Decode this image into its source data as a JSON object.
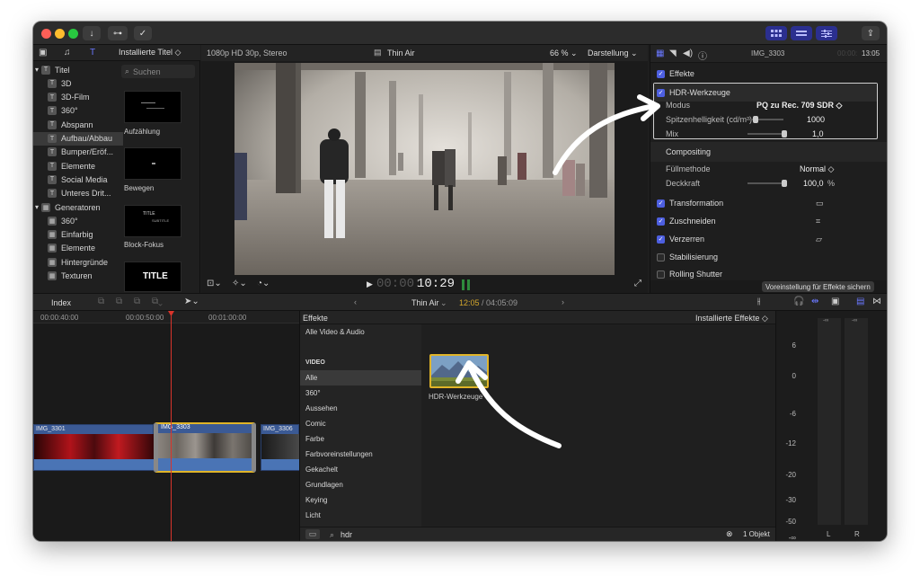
{
  "toolbar": {
    "download_icon": "↓",
    "key_icon": "⊶",
    "check_icon": "✓",
    "share_icon": "⇪"
  },
  "browser": {
    "header": "Installierte Titel ◇",
    "search_placeholder": "Suchen",
    "items": [
      {
        "label": "Titel",
        "level": 0
      },
      {
        "label": "3D",
        "level": 1
      },
      {
        "label": "3D-Film",
        "level": 1
      },
      {
        "label": "360°",
        "level": 1
      },
      {
        "label": "Abspann",
        "level": 1
      },
      {
        "label": "Aufbau/Abbau",
        "level": 1
      },
      {
        "label": "Bumper/Eröf...",
        "level": 1
      },
      {
        "label": "Elemente",
        "level": 1
      },
      {
        "label": "Social Media",
        "level": 1
      },
      {
        "label": "Unteres Drit...",
        "level": 1
      },
      {
        "label": "Generatoren",
        "level": 0
      },
      {
        "label": "360°",
        "level": 1
      },
      {
        "label": "Einfarbig",
        "level": 1
      },
      {
        "label": "Elemente",
        "level": 1
      },
      {
        "label": "Hintergründe",
        "level": 1
      },
      {
        "label": "Texturen",
        "level": 1
      }
    ],
    "thumbs": [
      "Aufzählung",
      "Bewegen",
      "Block-Fokus"
    ],
    "thumb_text": {
      "block": "TITLE",
      "block_sub": "SUBTITLE",
      "title_big": "TITLE"
    }
  },
  "viewer": {
    "format": "1080p HD 30p, Stereo",
    "project": "Thin Air",
    "zoom": "66 % ⌄",
    "view": "Darstellung ⌄",
    "timecode_dim": "00:00:",
    "timecode": "10:29"
  },
  "inspector": {
    "clip": "IMG_3303",
    "timecode_dim": "00:00:",
    "timecode": "13:05",
    "effects": "Effekte",
    "hdr": "HDR-Werkzeuge",
    "modus_label": "Modus",
    "modus_value": "PQ zu Rec. 709 SDR ◇",
    "peak_label": "Spitzenhelligkeit (cd/m²)",
    "peak_value": "1000",
    "mix_label": "Mix",
    "mix_value": "1,0",
    "compositing": "Compositing",
    "blend_label": "Füllmethode",
    "blend_value": "Normal ◇",
    "opacity_label": "Deckkraft",
    "opacity_value": "100,0",
    "opacity_unit": "%",
    "transform": "Transformation",
    "crop": "Zuschneiden",
    "distort": "Verzerren",
    "stabilize": "Stabilisierung",
    "rolling": "Rolling Shutter",
    "save_preset": "Voreinstellung für Effekte sichern"
  },
  "timeline": {
    "index": "Index",
    "project": "Thin Air",
    "time_current": "12:05",
    "time_total": "/ 04:05:09",
    "ruler": [
      "00:00:40:00",
      "00:00:50:00",
      "00:01:00:00"
    ],
    "clips": [
      "IMG_3301",
      "IMG_3303",
      "IMG_3306"
    ]
  },
  "effects_browser": {
    "title": "Effekte",
    "installed": "Installierte Effekte ◇",
    "categories": [
      "Alle Video & Audio",
      "",
      "VIDEO",
      "Alle",
      "360°",
      "Aussehen",
      "Comic",
      "Farbe",
      "Farbvoreinstellungen",
      "Gekachelt",
      "Grundlagen",
      "Keying",
      "Licht"
    ],
    "selected": "Alle",
    "result_label": "HDR-Werkzeuge",
    "search_value": "hdr",
    "count": "1 Objekt"
  },
  "meters": {
    "scale": [
      "6",
      "0",
      "-6",
      "-12",
      "-20",
      "-30",
      "-50",
      "-∞"
    ],
    "channels": [
      "L",
      "R"
    ],
    "peak": "-∞"
  },
  "colors": {
    "accent": "#4d5fe0",
    "window": "#1e1e1e",
    "clip_blue": "#3b5a95",
    "playhead": "#d9342b",
    "highlight": "#f2c94c"
  }
}
